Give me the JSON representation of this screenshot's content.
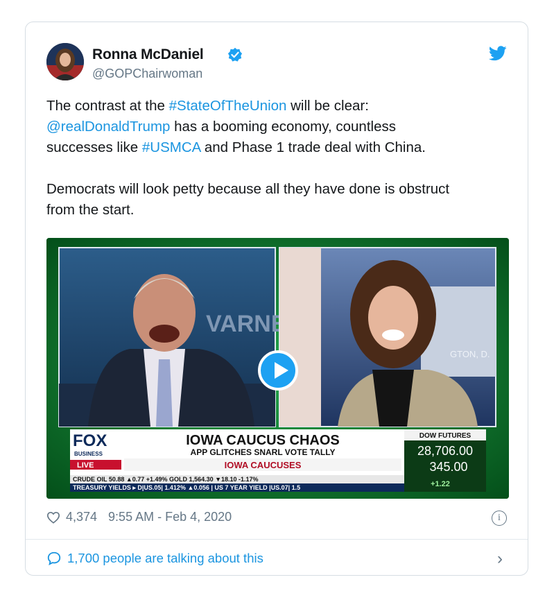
{
  "tweet": {
    "author_name": "Ronna McDaniel",
    "handle": "@GOPChairwoman",
    "body_1_a": "The contrast at the ",
    "body_1_tag": "#StateOfTheUnion",
    "body_1_b": " will be clear:",
    "body_2_mention": " @realDonaldTrump",
    "body_2_b": " has a booming economy, countless",
    "body_3_a": "successes like ",
    "body_3_tag": "#USMCA",
    "body_3_b": " and Phase 1 trade deal with China.",
    "body_4": "Democrats will look petty because all they have done is obstruct",
    "body_5": "from the start.",
    "likes": "4,374",
    "timestamp": "9:55 AM - Feb 4, 2020",
    "talking": "1,700 people are talking about this"
  },
  "video": {
    "brand": "FOX",
    "brand_sub": "BUSINESS",
    "live": "LIVE",
    "headline": "IOWA CAUCUS CHAOS",
    "subhead": "APP GLITCHES SNARL VOTE TALLY",
    "tag": "IOWA CAUCUSES",
    "dow_label": "DOW FUTURES",
    "dow_value": "28,706.00",
    "dow_change": "345.00",
    "dow_pct": "+1.22",
    "ticker_1": "CRUDE OIL   50.88 ▲0.77 +1.49% GOLD   1,564.30 ▼18.10 -1.17%",
    "ticker_2": "TREASURY YIELDS ▸ D|US.05| 1.412% ▲0.056 | US 7 YEAR YIELD |US.07| 1.5",
    "bg_word": "VARNE",
    "bg_word_2": "GTON, D."
  },
  "colors": {
    "link": "#1b95e0",
    "verified": "#1da1f2",
    "bird": "#1da1f2"
  }
}
